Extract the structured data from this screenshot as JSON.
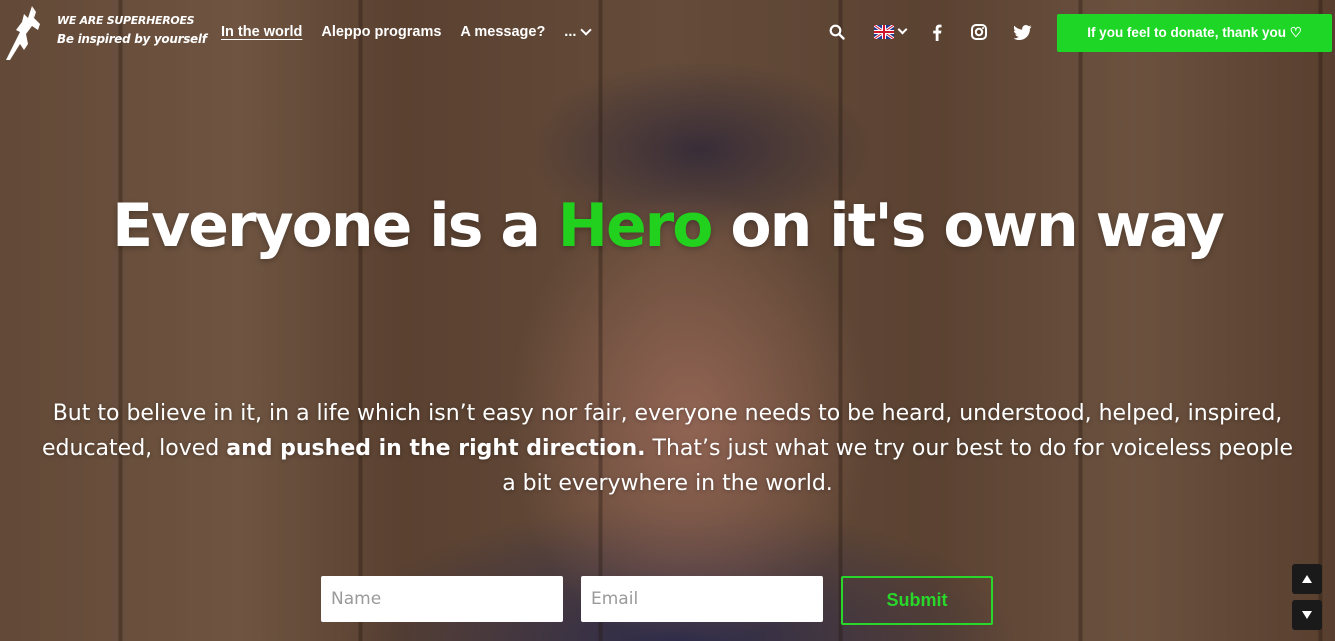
{
  "brand": {
    "title": "WE ARE SUPERHEROES",
    "tagline": "Be inspired by yourself"
  },
  "nav": {
    "items": [
      {
        "label": "In the world",
        "active": true
      },
      {
        "label": "Aleppo programs",
        "active": false
      },
      {
        "label": "A message?",
        "active": false
      },
      {
        "label": "...",
        "active": false
      }
    ]
  },
  "tools": {
    "search_icon": "search-icon",
    "language_icon": "uk-flag-icon",
    "social": [
      "facebook-icon",
      "instagram-icon",
      "twitter-icon"
    ]
  },
  "donate_button": {
    "label": "If you feel to donate, thank you ♡",
    "color": "#1ed626"
  },
  "hero": {
    "headline_before": "Everyone is a ",
    "headline_highlight": "Hero",
    "headline_after": " on it's own way",
    "highlight_color": "#22d11e",
    "lead_part1": "But to believe in it, in a life which isn’t easy nor fair, everyone needs to be heard, understood, helped, inspired, educated, loved ",
    "lead_bold": "and pushed in the right direction.",
    "lead_part2": " That’s just what we try our best to do for voiceless people a bit everywhere in the world."
  },
  "form": {
    "name_placeholder": "Name",
    "email_placeholder": "Email",
    "name_value": "",
    "email_value": "",
    "submit_label": "Submit"
  }
}
